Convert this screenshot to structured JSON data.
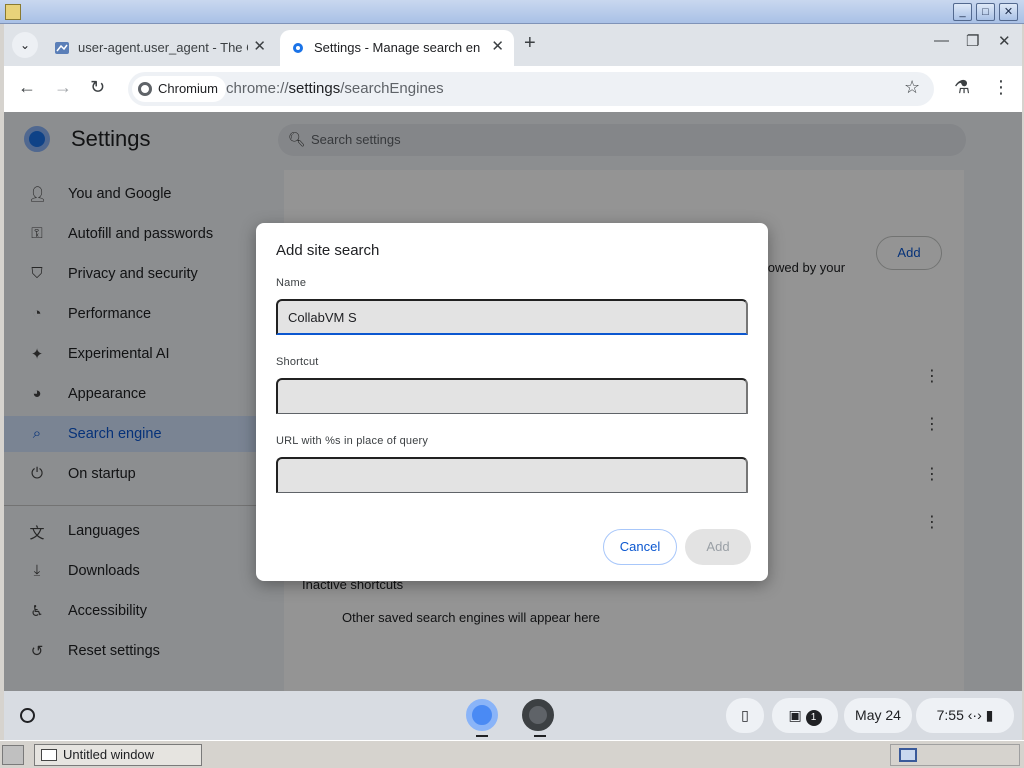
{
  "browser": {
    "tabs": [
      {
        "title": "user-agent.user_agent - The C",
        "active": false
      },
      {
        "title": "Settings - Manage search engi",
        "active": true
      }
    ],
    "new_tab_glyph": "+",
    "omnibox": {
      "chip_label": "Chromium",
      "url_prefix": "chrome://",
      "url_host": "settings",
      "url_path": "/searchEngines"
    }
  },
  "settings": {
    "title": "Settings",
    "search_placeholder": "Search settings",
    "sidebar": [
      {
        "label": "You and Google",
        "icon": "person-icon"
      },
      {
        "label": "Autofill and passwords",
        "icon": "key-icon"
      },
      {
        "label": "Privacy and security",
        "icon": "shield-icon"
      },
      {
        "label": "Performance",
        "icon": "speedometer-icon"
      },
      {
        "label": "Experimental AI",
        "icon": "sparkle-icon"
      },
      {
        "label": "Appearance",
        "icon": "palette-icon"
      },
      {
        "label": "Search engine",
        "icon": "search-icon",
        "selected": true
      },
      {
        "label": "On startup",
        "icon": "power-icon"
      },
      {
        "label": "Languages",
        "icon": "translate-icon"
      },
      {
        "label": "Downloads",
        "icon": "download-icon"
      },
      {
        "label": "Accessibility",
        "icon": "accessibility-icon"
      },
      {
        "label": "Reset settings",
        "icon": "reset-icon"
      }
    ],
    "content": {
      "add_button": "Add",
      "allowed_text": "llowed by your",
      "inactive_heading": "Inactive shortcuts",
      "inactive_empty": "Other saved search engines will appear here"
    }
  },
  "dialog": {
    "title": "Add site search",
    "name_label": "Name",
    "name_value": "CollabVM S",
    "shortcut_label": "Shortcut",
    "shortcut_value": "",
    "url_label": "URL with %s in place of query",
    "url_value": "",
    "cancel_label": "Cancel",
    "add_label": "Add"
  },
  "shelf": {
    "date": "May 24",
    "time": "7:55",
    "notification_count": "1"
  },
  "xtaskbar": {
    "window_title": "Untitled window"
  },
  "colors": {
    "accent": "#0b57d0",
    "selected_bg": "#d3e3fd"
  }
}
